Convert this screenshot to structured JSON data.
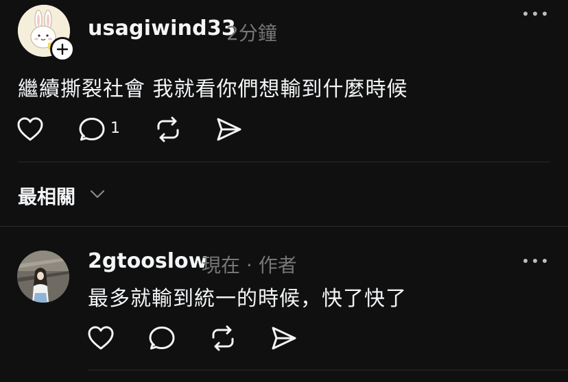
{
  "post": {
    "username": "usagiwind33",
    "time": "2分鐘",
    "text": "繼續撕裂社會 我就看你們想輸到什麼時候",
    "reply_count": "1",
    "avatar_icon": "rabbit-avatar",
    "follow_icon": "plus-icon"
  },
  "sort": {
    "label": "最相關",
    "icon": "chevron-down-icon"
  },
  "reply": {
    "username": "2gtooslow",
    "time": "現在",
    "separator": "·",
    "author_tag": "作者",
    "text": "最多就輸到統一的時候，快了快了",
    "avatar_icon": "profile-photo"
  },
  "colors": {
    "background": "#101010",
    "text": "#f3f5f7",
    "muted": "#777777",
    "divider": "#2a2a2a"
  }
}
